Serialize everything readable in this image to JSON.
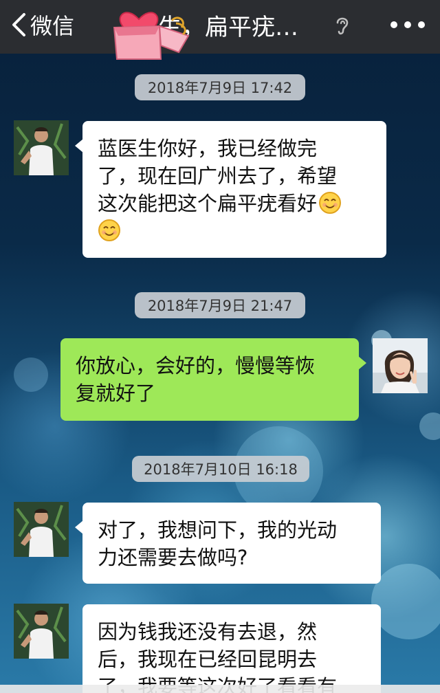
{
  "header": {
    "back_label": "微信",
    "title": "生，扁平疣…"
  },
  "messages": [
    {
      "timestamp": "2018年7月9日 17:42",
      "side": "left",
      "lines": [
        "蓝医生你好，我已经做完",
        "了，现在回广州去了，希望",
        "这次能把这个扁平疣看好"
      ],
      "emoji": [
        "smile-emoji",
        "smile-emoji"
      ]
    },
    {
      "timestamp": "2018年7月9日 21:47",
      "side": "right",
      "lines": [
        "你放心，会好的，慢慢等恢",
        "复就好了"
      ]
    },
    {
      "timestamp": "2018年7月10日 16:18",
      "side": "left",
      "lines": [
        "对了，我想问下，我的光动",
        "力还需要去做吗?"
      ]
    },
    {
      "side": "left",
      "lines": [
        "因为钱我还没有去退，然",
        "后，我现在已经回昆明去",
        "了，我要等这次好了看看有"
      ]
    }
  ],
  "icons": {
    "back": "chevron-left-icon",
    "ear": "ear-icon",
    "more": "more-dots-icon",
    "sticker": "gift-heart-sticker"
  },
  "colors": {
    "topbar": "#2b2d31",
    "received_bubble": "#ffffff",
    "sent_bubble": "#9ee858",
    "timestamp_bg": "#c8cdd2"
  }
}
